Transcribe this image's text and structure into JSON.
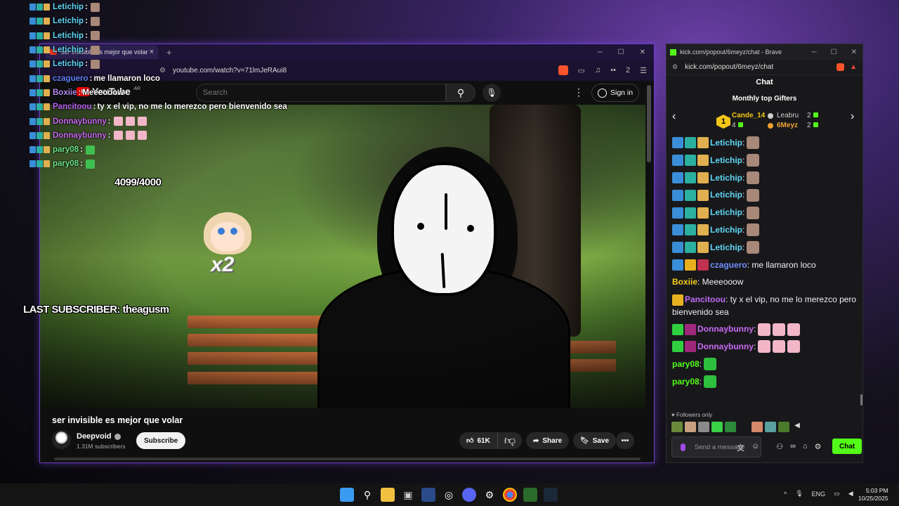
{
  "overlay": {
    "chat": [
      {
        "name": "Letichip",
        "text": "",
        "color": "#5fd6f5",
        "emote": true
      },
      {
        "name": "Letichip",
        "text": "",
        "color": "#5fd6f5",
        "emote": true
      },
      {
        "name": "Letichip",
        "text": "",
        "color": "#5fd6f5",
        "emote": true
      },
      {
        "name": "Letichip",
        "text": "",
        "color": "#5fd6f5",
        "emote": true
      },
      {
        "name": "Letichip",
        "text": "",
        "color": "#5fd6f5",
        "emote": true
      },
      {
        "name": "czaguero",
        "text": "me llamaron loco",
        "color": "#5f7ff5",
        "emote": false
      },
      {
        "name": "Boxiie",
        "text": "Meeeooow",
        "color": "#b58cf5",
        "emote": false
      },
      {
        "name": "Pancitoou",
        "text": "ty x el vip, no me lo merezco pero bienvenido sea",
        "color": "#b85cf5",
        "emote": false
      },
      {
        "name": "Donnaybunny",
        "text": "",
        "color": "#c86af2",
        "emote": true,
        "emotes": 3
      },
      {
        "name": "Donnaybunny",
        "text": "",
        "color": "#c86af2",
        "emote": true,
        "emotes": 3
      },
      {
        "name": "pary08",
        "text": "",
        "color": "#6ee38a",
        "emote": true
      },
      {
        "name": "pary08",
        "text": "",
        "color": "#6ee38a",
        "emote": true
      }
    ],
    "sub_goal": "4099/4000",
    "mascot_multiplier": "x2",
    "last_subscriber": "LAST SUBSCRIBER: theagusm"
  },
  "youtube": {
    "tab_title": "ser invisible es mejor que volar",
    "url": "youtube.com/watch?v=71lmJeRAui8",
    "logo_text": "YouTube",
    "region": "AR",
    "search_placeholder": "Search",
    "sign_in": "Sign in",
    "brave_badge": "2",
    "video_title": "ser invisible es mejor que volar",
    "channel_name": "Deepvoid",
    "channel_subs": "1.31M subscribers",
    "subscribe": "Subscribe",
    "likes": "61K",
    "share": "Share",
    "save": "Save"
  },
  "kick": {
    "window_title": "kick.com/popout/6meyz/chat - Brave",
    "url": "kick.com/popout/6meyz/chat",
    "chat_title": "Chat",
    "gifters_title": "Monthly top Gifters",
    "gifters": [
      {
        "rank": "1",
        "name": "Cande_14",
        "count": "4",
        "color": "#f5c518"
      },
      {
        "name": "Leabru",
        "count": "2",
        "color": "#cfcfcf"
      },
      {
        "name": "6Meyz",
        "count": "2",
        "color": "#f0a030"
      }
    ],
    "messages": [
      {
        "name": "Letichip",
        "text": ":",
        "color": "#5fd6f5",
        "badges": [
          "#3a8ed8",
          "#2bb0a0",
          "#e0b050"
        ],
        "emotes": 1
      },
      {
        "name": "Letichip",
        "text": ":",
        "color": "#5fd6f5",
        "badges": [
          "#3a8ed8",
          "#2bb0a0",
          "#e0b050"
        ],
        "emotes": 1
      },
      {
        "name": "Letichip",
        "text": ":",
        "color": "#5fd6f5",
        "badges": [
          "#3a8ed8",
          "#2bb0a0",
          "#e0b050"
        ],
        "emotes": 1
      },
      {
        "name": "Letichip",
        "text": ":",
        "color": "#5fd6f5",
        "badges": [
          "#3a8ed8",
          "#2bb0a0",
          "#e0b050"
        ],
        "emotes": 1
      },
      {
        "name": "Letichip",
        "text": ":",
        "color": "#5fd6f5",
        "badges": [
          "#3a8ed8",
          "#2bb0a0",
          "#e0b050"
        ],
        "emotes": 1
      },
      {
        "name": "Letichip",
        "text": ":",
        "color": "#5fd6f5",
        "badges": [
          "#3a8ed8",
          "#2bb0a0",
          "#e0b050"
        ],
        "emotes": 1
      },
      {
        "name": "Letichip",
        "text": ":",
        "color": "#5fd6f5",
        "badges": [
          "#3a8ed8",
          "#2bb0a0",
          "#e0b050"
        ],
        "emotes": 1
      },
      {
        "name": "czaguero",
        "text": ": me llamaron loco",
        "color": "#6f8ff8",
        "badges": [
          "#3a8ed8",
          "#e8b020",
          "#c03050"
        ],
        "emotes": 0
      },
      {
        "name": "Boxiie",
        "text": ": Meeeooow",
        "color": "#f5d020",
        "badges": [],
        "emotes": 0
      },
      {
        "name": "Pancitoou",
        "text": ": ty x el vip, no me lo merezco pero bienvenido sea",
        "color": "#c06af5",
        "badges": [
          "#e8b020"
        ],
        "emotes": 0,
        "wrap": true
      },
      {
        "name": "Donnaybunny",
        "text": ":",
        "color": "#c86af2",
        "badges": [
          "#2fcf3f",
          "#a0287c"
        ],
        "emotes": 3
      },
      {
        "name": "Donnaybunny",
        "text": ":",
        "color": "#c86af2",
        "badges": [
          "#2fcf3f",
          "#a0287c"
        ],
        "emotes": 3
      },
      {
        "name": "pary08",
        "text": ":",
        "color": "#53fc18",
        "badges": [],
        "emotes": 1
      },
      {
        "name": "pary08",
        "text": ":",
        "color": "#53fc18",
        "badges": [],
        "emotes": 1
      }
    ],
    "followers_only": "Followers only",
    "input_placeholder": "Send a message",
    "send_label": "Chat"
  },
  "taskbar": {
    "lang": "ENG",
    "time": "5:03 PM",
    "date": "10/25/2025"
  }
}
